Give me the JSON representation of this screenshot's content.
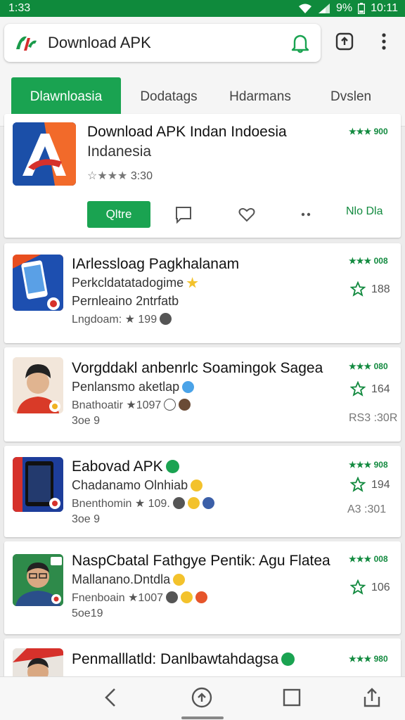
{
  "status_bar": {
    "time": "1:33",
    "battery": "9%",
    "clock": "10:11"
  },
  "search": {
    "text": "Download APK"
  },
  "tabs": [
    {
      "label": "Dlawnloasia",
      "active": true
    },
    {
      "label": "Dodatags",
      "active": false
    },
    {
      "label": "Hdarmans",
      "active": false
    },
    {
      "label": "Dvslen",
      "active": false
    }
  ],
  "featured": {
    "title": "Download APK  Indan Indoesia",
    "subtitle": "Indanesia",
    "rating_text": "3:30",
    "rating_badge": "★★★ 900",
    "install_label": "Qltre",
    "more_label": "Nlo Dla"
  },
  "apps": [
    {
      "title": "IArlessloag Pagkhalanam",
      "line1": "Perkcldatatadogime",
      "line2": "Pernleaino 2ntrfatb",
      "line3": "Lngdoam: ★ 199",
      "rating_badge": "★★★ 008",
      "side_num": "188",
      "extra": ""
    },
    {
      "title": "Vorgddakl anbenrlc Soamingok Sagea",
      "line1": "Penlansmo aketlap",
      "line2": "Bnathoatir ★1097",
      "line3": "3oe 9",
      "rating_badge": "★★★ 080",
      "side_num": "164",
      "extra": "RS3 :30R"
    },
    {
      "title": "Eabovad  APK",
      "line1": "Chadanamo Olnhiab",
      "line2": "Bnenthomin ★ 109.",
      "line3": "3oe 9",
      "rating_badge": "★★★ 908",
      "side_num": "194",
      "extra": "A3 :301"
    },
    {
      "title": "NaspCbatal  Fathgye Pentik: Agu Flatea",
      "line1": "Mallanano.Dntdla",
      "line2": "Fnenboain ★1007",
      "line3": "5oe19",
      "rating_badge": "★★★ 008",
      "side_num": "106",
      "extra": ""
    },
    {
      "title": "Penmalllatld: Danlbawtahdagsa",
      "line1": "",
      "line2": "",
      "line3": "",
      "rating_badge": "★★★ 980",
      "side_num": "",
      "extra": ""
    }
  ],
  "icons": {
    "search_logo": "apk-logo-icon",
    "bell": "bell-icon",
    "upload": "upload-icon",
    "more": "more-vert-icon",
    "nav": [
      "back-icon",
      "home-icon",
      "recents-icon",
      "share-icon"
    ]
  },
  "colors": {
    "accent": "#1aa351",
    "status_bar": "#0f8a3c"
  }
}
